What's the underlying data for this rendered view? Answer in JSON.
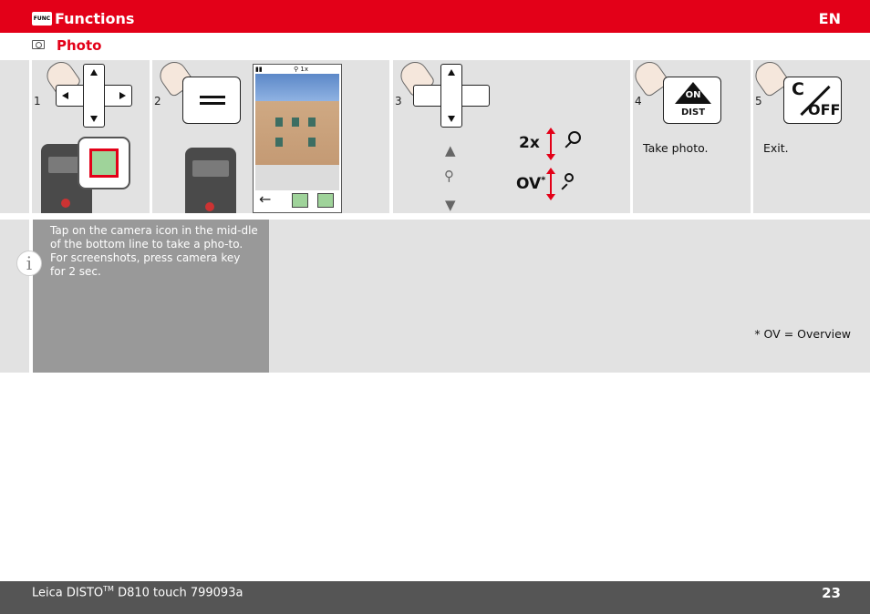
{
  "header": {
    "icon_text": "FUNC",
    "title": "Functions",
    "lang": "EN"
  },
  "subtitle": {
    "title": "Photo"
  },
  "steps": [
    {
      "num": "1",
      "text": ""
    },
    {
      "num": "2",
      "text": ""
    },
    {
      "num": "3",
      "text": ""
    },
    {
      "num": "4",
      "text": "Take photo."
    },
    {
      "num": "5",
      "text": "Exit."
    }
  ],
  "phone": {
    "zoom": "1x"
  },
  "zoom_controls": {
    "two_x": "2x",
    "ov": "OV",
    "ov_marker": "*"
  },
  "keys": {
    "on": "ON",
    "dist": "DIST",
    "c": "C",
    "off": "OFF"
  },
  "info": {
    "icon": "i",
    "line1": "Tap on the  camera icon in the mid-dle of the bottom line to take a pho-to.",
    "line2": "For screenshots, press camera key for 2 sec.",
    "note": "* OV = Overview"
  },
  "footer": {
    "brand": "Leica DISTO",
    "tm": "TM",
    "model": " D810 touch 799093a",
    "page": "23"
  },
  "colors": {
    "brand_red": "#e30018",
    "panel_gray": "#e2e2e2",
    "info_gray": "#999999",
    "footer_gray": "#555555"
  }
}
